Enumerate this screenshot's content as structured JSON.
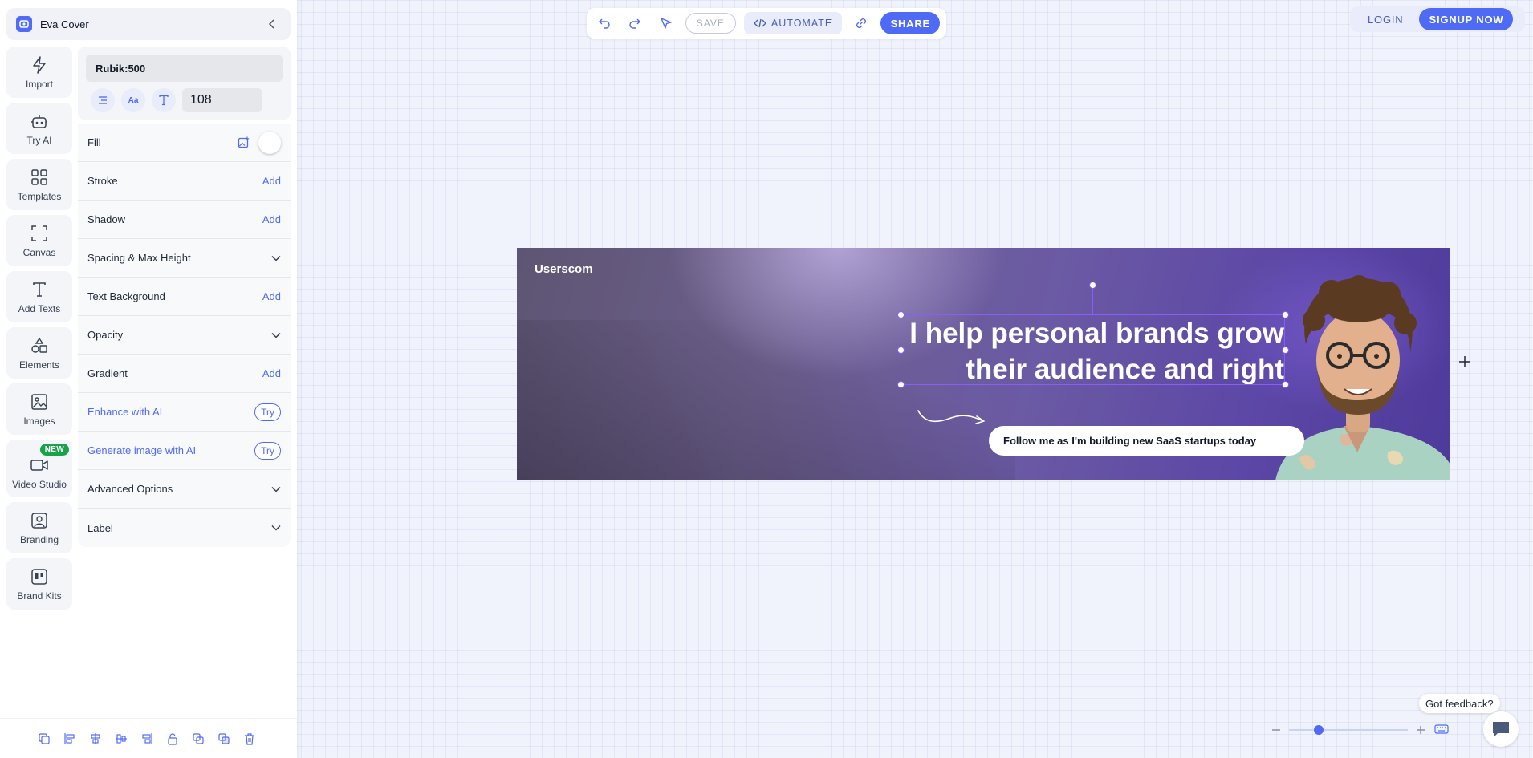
{
  "header": {
    "document_name": "Eva Cover"
  },
  "tool_rail": {
    "items": [
      {
        "label": "Import",
        "icon": "lightning-icon"
      },
      {
        "label": "Try AI",
        "icon": "robot-icon"
      },
      {
        "label": "Templates",
        "icon": "grid-icon"
      },
      {
        "label": "Canvas",
        "icon": "frame-icon"
      },
      {
        "label": "Add Texts",
        "icon": "text-icon"
      },
      {
        "label": "Elements",
        "icon": "shapes-icon"
      },
      {
        "label": "Images",
        "icon": "image-icon"
      },
      {
        "label": "Video Studio",
        "icon": "video-icon",
        "badge": "NEW"
      },
      {
        "label": "Branding",
        "icon": "person-badge-icon"
      },
      {
        "label": "Brand Kits",
        "icon": "brand-kit-icon"
      }
    ]
  },
  "properties": {
    "font_family": "Rubik:500",
    "font_size": "108",
    "fill_label": "Fill",
    "stroke_label": "Stroke",
    "shadow_label": "Shadow",
    "spacing_label": "Spacing & Max Height",
    "text_background_label": "Text Background",
    "opacity_label": "Opacity",
    "gradient_label": "Gradient",
    "enhance_ai_label": "Enhance with AI",
    "generate_image_label": "Generate image with AI",
    "advanced_label": "Advanced Options",
    "label_label": "Label",
    "add_text": "Add",
    "try_text": "Try"
  },
  "toolbar": {
    "save_label": "SAVE",
    "automate_label": "AUTOMATE",
    "share_label": "SHARE"
  },
  "auth": {
    "login_label": "LOGIN",
    "signup_label": "SIGNUP NOW"
  },
  "canvas": {
    "brand_text": "Userscom",
    "headline_line1": "I help personal brands grow",
    "headline_line2": "their audience and right",
    "cta_text": "Follow me as I'm building new SaaS startups today"
  },
  "zoom": {
    "level_fraction": 0.25
  },
  "feedback": {
    "label": "Got feedback?"
  },
  "colors": {
    "accent": "#4f6bf6",
    "selection": "#8b5cf6",
    "new_badge": "#16a34a"
  }
}
